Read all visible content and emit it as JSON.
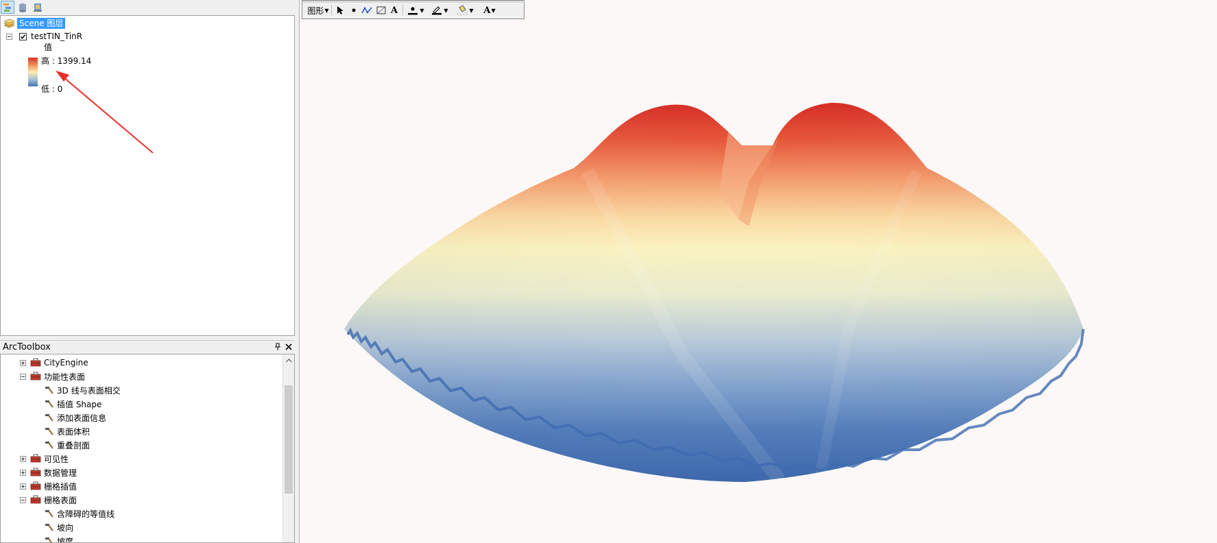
{
  "toc": {
    "root_label": "Scene 图层",
    "layer_name": "testTIN_TinR",
    "legend": {
      "field": "值",
      "high_label": "高 : 1399.14",
      "low_label": "低 : 0",
      "ramp_colors": [
        "#d73027",
        "#f08c56",
        "#fdebae",
        "#a9c1d4",
        "#4575b4"
      ]
    }
  },
  "arctoolbox": {
    "title": "ArcToolbox",
    "pin_icon": "pin-icon",
    "close_icon": "close-icon",
    "items": [
      {
        "label": "CityEngine",
        "type": "toolbox",
        "expanded": false
      },
      {
        "label": "功能性表面",
        "type": "toolbox",
        "expanded": true
      },
      {
        "label": "3D 线与表面相交",
        "type": "tool"
      },
      {
        "label": "插值 Shape",
        "type": "tool"
      },
      {
        "label": "添加表面信息",
        "type": "tool"
      },
      {
        "label": "表面体积",
        "type": "tool"
      },
      {
        "label": "重叠剖面",
        "type": "tool"
      },
      {
        "label": "可见性",
        "type": "toolbox",
        "expanded": false
      },
      {
        "label": "数据管理",
        "type": "toolbox",
        "expanded": false
      },
      {
        "label": "栅格插值",
        "type": "toolbox",
        "expanded": false
      },
      {
        "label": "栅格表面",
        "type": "toolbox",
        "expanded": true
      },
      {
        "label": "含障碍的等值线",
        "type": "tool"
      },
      {
        "label": "坡向",
        "type": "tool"
      },
      {
        "label": "坡度",
        "type": "tool"
      }
    ]
  },
  "draw_toolbar": {
    "menu_label": "图形",
    "tools": [
      "select-pointer-icon",
      "point-icon",
      "polyline-icon",
      "rectangle-icon",
      "text-icon",
      "marker-color-icon",
      "line-color-icon",
      "fill-color-icon",
      "font-color-icon"
    ]
  },
  "colors": {
    "selection": "#3399ff",
    "annotation_arrow": "#e8302a",
    "scene_background": "#fcf8f7"
  }
}
